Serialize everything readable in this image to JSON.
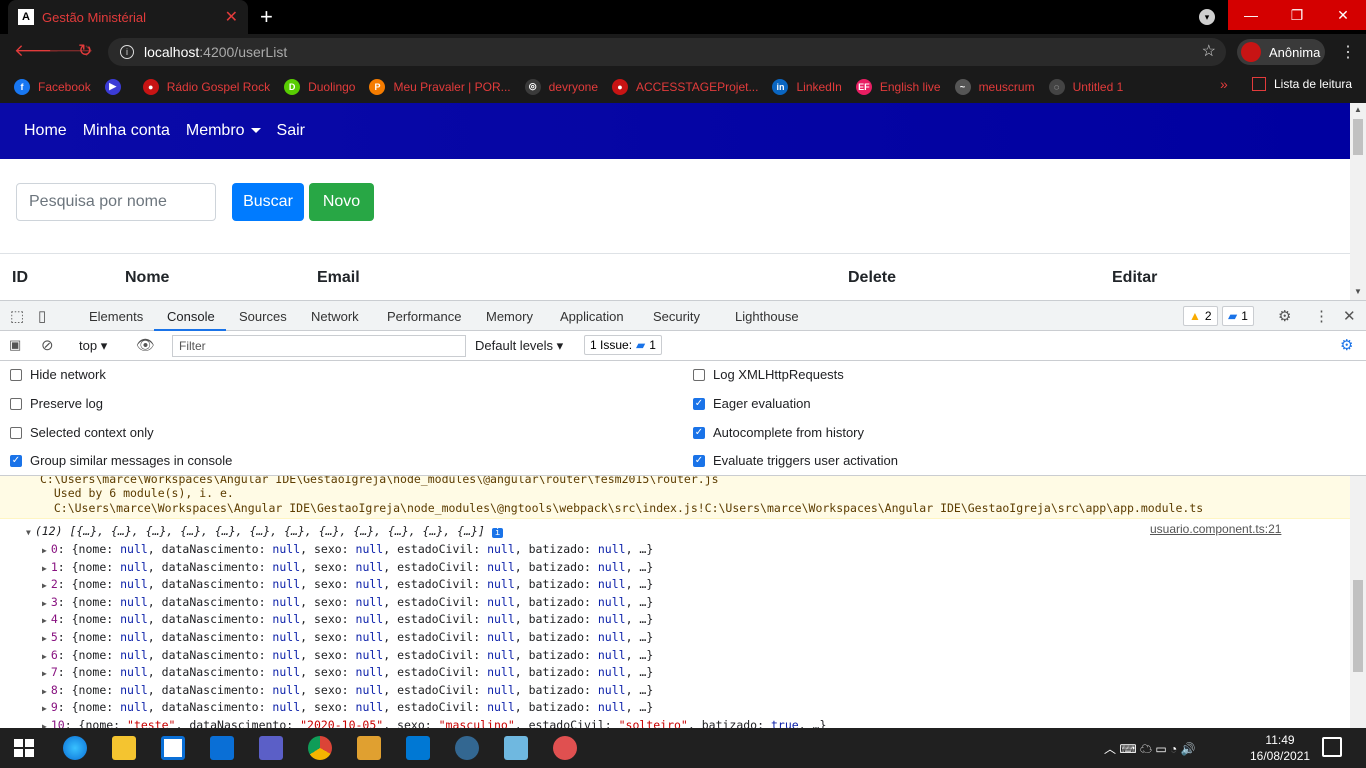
{
  "browser": {
    "tab_title": "Gestão Ministérial",
    "tab_favicon": "A",
    "url_host": "localhost",
    "url_path": ":4200/userList",
    "profile_label": "Anônima",
    "bookmarks": [
      {
        "label": "Facebook",
        "color": "#1877f2",
        "glyph": "f"
      },
      {
        "label": "",
        "color": "#3b3bd6",
        "glyph": "▶"
      },
      {
        "label": "Rádio Gospel Rock",
        "color": "#c81414",
        "glyph": "●"
      },
      {
        "label": "Duolingo",
        "color": "#58cc02",
        "glyph": "D"
      },
      {
        "label": "Meu Pravaler | POR...",
        "color": "#f57c00",
        "glyph": "P"
      },
      {
        "label": "devryone",
        "color": "#3a3a3a",
        "glyph": "◎"
      },
      {
        "label": "ACCESSTAGEProjet...",
        "color": "#c81414",
        "glyph": "●"
      },
      {
        "label": "LinkedIn",
        "color": "#0a66c2",
        "glyph": "in"
      },
      {
        "label": "English live",
        "color": "#e91e63",
        "glyph": "EF"
      },
      {
        "label": "meuscrum",
        "color": "#555555",
        "glyph": "~"
      },
      {
        "label": "Untitled 1",
        "color": "#444444",
        "glyph": "◌"
      }
    ],
    "reading_list": "Lista de leitura"
  },
  "app": {
    "nav": [
      "Home",
      "Minha conta",
      "Membro",
      "Sair"
    ],
    "search_placeholder": "Pesquisa por nome",
    "btn_search": "Buscar",
    "btn_new": "Novo",
    "table_headers": [
      "ID",
      "Nome",
      "Email",
      "Delete",
      "Editar"
    ],
    "colors": {
      "nav": "#0000a0",
      "primary": "#007bff",
      "success": "#28a745"
    }
  },
  "devtools": {
    "tabs": [
      "Elements",
      "Console",
      "Sources",
      "Network",
      "Performance",
      "Memory",
      "Application",
      "Security",
      "Lighthouse"
    ],
    "warnings_count": "2",
    "messages_count": "1",
    "context": "top",
    "filter_placeholder": "Filter",
    "levels": "Default levels",
    "issues": "1 Issue:",
    "issues_count": "1",
    "settings_left": [
      {
        "label": "Hide network",
        "checked": false
      },
      {
        "label": "Preserve log",
        "checked": false
      },
      {
        "label": "Selected context only",
        "checked": false
      },
      {
        "label": "Group similar messages in console",
        "checked": true
      }
    ],
    "settings_right": [
      {
        "label": "Log XMLHttpRequests",
        "checked": false
      },
      {
        "label": "Eager evaluation",
        "checked": true
      },
      {
        "label": "Autocomplete from history",
        "checked": true
      },
      {
        "label": "Evaluate triggers user activation",
        "checked": true
      }
    ],
    "warning_lines": [
      "C:\\Users\\marce\\Workspaces\\Angular IDE\\GestaoIgreja\\node_modules\\@angular\\router\\fesm2015\\router.js",
      "  Used by 6 module(s), i. e.",
      "  C:\\Users\\marce\\Workspaces\\Angular IDE\\GestaoIgreja\\node_modules\\@ngtools\\webpack\\src\\index.js!C:\\Users\\marce\\Workspaces\\Angular IDE\\GestaoIgreja\\src\\app\\app.module.ts"
    ],
    "array_header": "(12) [{…}, {…}, {…}, {…}, {…}, {…}, {…}, {…}, {…}, {…}, {…}, {…}]",
    "source_link": "usuario.component.ts:21",
    "rows": [
      "{nome: null, dataNascimento: null, sexo: null, estadoCivil: null, batizado: null, …}"
    ],
    "row_count": 10,
    "last_row": "{nome: \"teste\", dataNascimento: \"2020-10-05\", sexo: \"masculino\", estadoCivil: \"solteiro\", batizado: true, …}"
  },
  "taskbar": {
    "time": "11:49",
    "date": "16/08/2021"
  }
}
